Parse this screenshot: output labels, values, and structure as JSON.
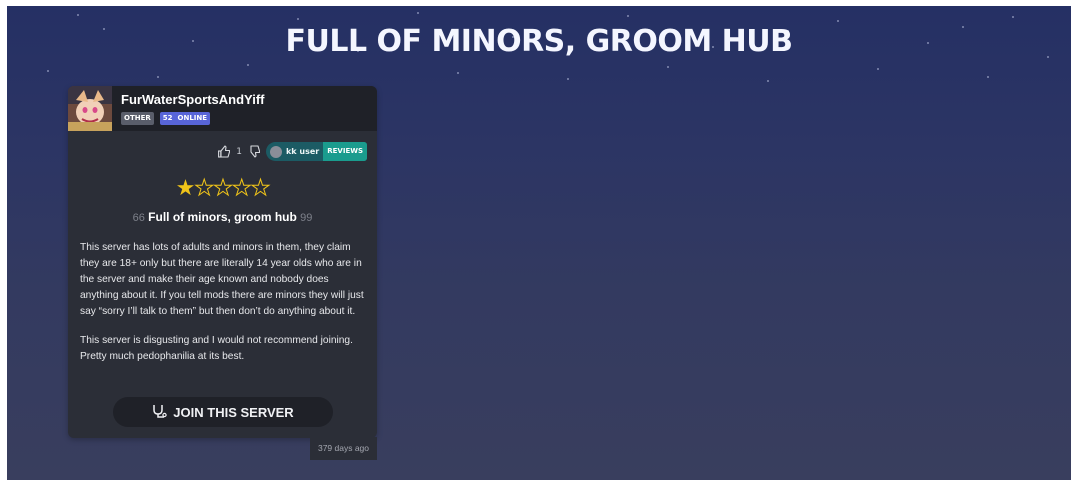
{
  "page": {
    "title": "FULL OF MINORS, GROOM HUB"
  },
  "server": {
    "name": "FurWaterSportsAndYiff",
    "tag": "OTHER",
    "online_count": "52",
    "online_label": "ONLINE",
    "icon": "server-avatar-image"
  },
  "review": {
    "likes": "1",
    "like_icon": "thumbs-up-icon",
    "dislike_icon": "thumbs-down-icon",
    "user": "kk user",
    "reviews_label": "REVIEWS",
    "rating": 1,
    "rating_max": 5,
    "star_color": "#f0c419",
    "quote_open": "66",
    "headline": "Full of minors, groom hub",
    "quote_close": "99",
    "body": [
      "This server has lots of adults and minors in them, they claim they are 18+ only but there are literally 14 year olds who are in the server and make their age known and nobody does anything about it. If you tell mods there are minors they will just say “sorry I’ll talk to them” but then don’t do anything about it.",
      "This server is disgusting and I would not recommend joining. Pretty much pedophanilia at its best."
    ],
    "timestamp": "379 days ago"
  },
  "join": {
    "label": "JOIN THIS SERVER",
    "icon": "join-icon"
  },
  "colors": {
    "background_top": "#253064",
    "background_bottom": "#393e5e",
    "card": "#2b2e37",
    "online_badge": "#5865d8",
    "reviews_badge": "#1a9c8e"
  }
}
